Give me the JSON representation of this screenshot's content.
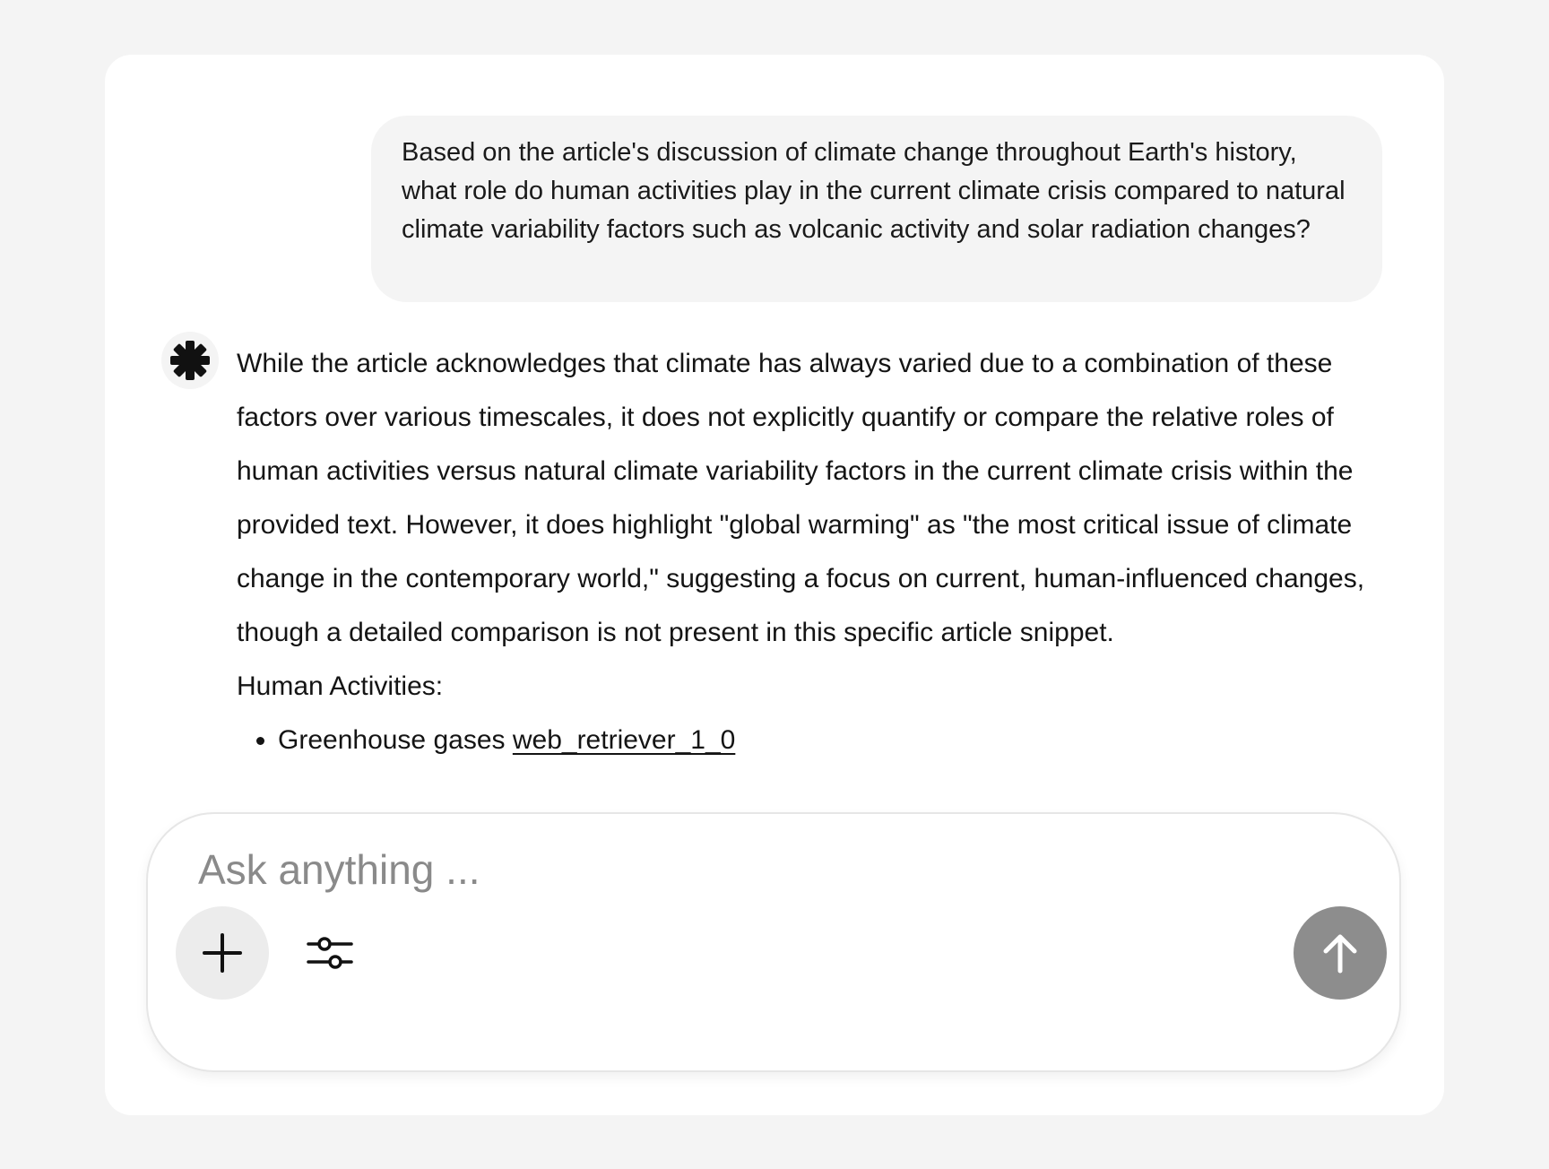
{
  "conversation": {
    "user_message": "Based on the article's discussion of climate change throughout Earth's history, what role do human activities play in the current climate crisis compared to natural climate variability factors such as volcanic activity and solar radiation changes?",
    "assistant": {
      "avatar_icon": "asterisk-logo-icon",
      "paragraph": "While the article acknowledges that climate has always varied due to a combination of these factors over various timescales, it does not explicitly quantify or compare the relative roles of human activities versus natural climate variability factors in the current climate crisis within the provided text. However, it does highlight \"global warming\" as \"the most critical issue of climate change in the contemporary world,\" suggesting a focus on current, human-influenced changes, though a detailed comparison is not present in this specific article snippet.",
      "section_title": "Human Activities:",
      "bullets": [
        {
          "text": "Greenhouse gases ",
          "citation": "web_retriever_1_0"
        }
      ]
    }
  },
  "composer": {
    "placeholder": "Ask anything ...",
    "value": "",
    "add_icon": "plus-icon",
    "settings_icon": "sliders-icon",
    "send_icon": "arrow-up-icon",
    "send_button_color": "#8d8d8d"
  }
}
